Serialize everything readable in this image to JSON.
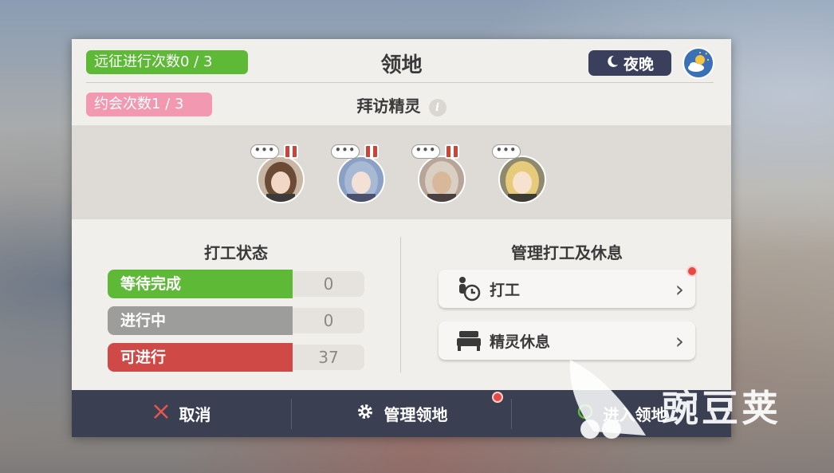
{
  "header": {
    "title": "领地",
    "expedition_count": "远征进行次数0 / 3",
    "date_count": "约会次数1 / 3",
    "time_of_day": "夜晚"
  },
  "visit": {
    "title": "拜访精灵",
    "info_icon": "i",
    "spirits": [
      {
        "bubble": "•••",
        "has_gift": true,
        "hair": "#6b4a36",
        "skin": "#f1d8c6"
      },
      {
        "bubble": "•••",
        "has_gift": true,
        "hair": "#a8b9d6",
        "skin": "#f3e1d6"
      },
      {
        "bubble": "•••",
        "has_gift": true,
        "hair": "#d9cfc3",
        "skin": "#d8b79a"
      },
      {
        "bubble": "•••",
        "has_gift": false,
        "hair": "#e6cc7a",
        "skin": "#f6e2cf"
      }
    ]
  },
  "work_status": {
    "title": "打工状态",
    "rows": [
      {
        "label": "等待完成",
        "count": "0",
        "color": "#5db936"
      },
      {
        "label": "进行中",
        "count": "0",
        "color": "#9d9d9b"
      },
      {
        "label": "可进行",
        "count": "37",
        "color": "#cf4a47"
      }
    ]
  },
  "manage": {
    "title": "管理打工及休息",
    "work_label": "打工",
    "rest_label": "精灵休息"
  },
  "footer": {
    "cancel": "取消",
    "manage_territory": "管理领地",
    "enter_territory": "进入领地"
  },
  "watermark": "豌豆荚",
  "colors": {
    "accent_green": "#5db936",
    "accent_pink": "#f298b0",
    "alert_red": "#e74a44",
    "footer_bg": "#3a3f52"
  }
}
